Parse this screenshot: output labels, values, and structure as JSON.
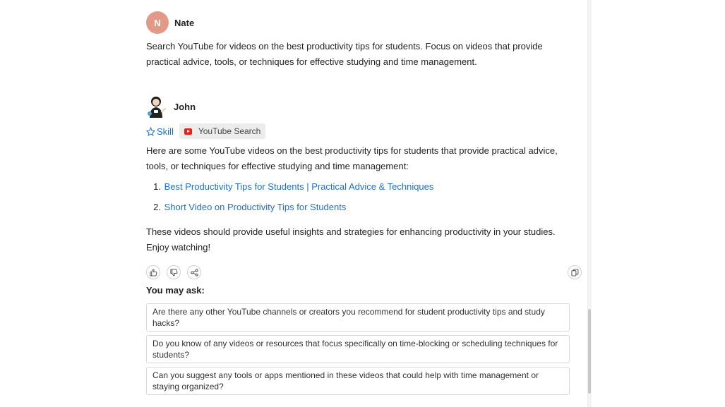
{
  "user_message": {
    "avatar_letter": "N",
    "avatar_color": "#e29a86",
    "author": "Nate",
    "text": "Search YouTube for videos on the best productivity tips for students. Focus on videos that provide practical advice, tools, or techniques for effective studying and time management."
  },
  "bot_message": {
    "author": "John",
    "avatar_icon": "cartoon-avatar-icon",
    "skill_label": "Skill",
    "skill_icon": "sparkle-star-icon",
    "tool_chip": "YouTube Search",
    "tool_icon": "youtube-logo-icon",
    "intro": "Here are some YouTube videos on the best productivity tips for students that provide practical advice, tools, or techniques for effective studying and time management:",
    "videos": [
      {
        "number": "1.",
        "title": "Best Productivity Tips for Students | Practical Advice & Techniques"
      },
      {
        "number": "2.",
        "title": "Short Video on Productivity Tips for Students"
      }
    ],
    "outro": "These videos should provide useful insights and strategies for enhancing productivity in your studies. Enjoy watching!",
    "link_color": "#1f6fc5"
  },
  "actions": {
    "icons": [
      "thumbs-up-icon",
      "thumbs-down-icon",
      "share-icon",
      "copy-icon"
    ]
  },
  "suggestions": {
    "title": "You may ask:",
    "items": [
      "Are there any other YouTube channels or creators you recommend for student productivity tips and study hacks?",
      "Do you know of any videos or resources that focus specifically on time-blocking or scheduling techniques for students?",
      "Can you suggest any tools or apps mentioned in these videos that could help with time management or staying organized?"
    ]
  }
}
